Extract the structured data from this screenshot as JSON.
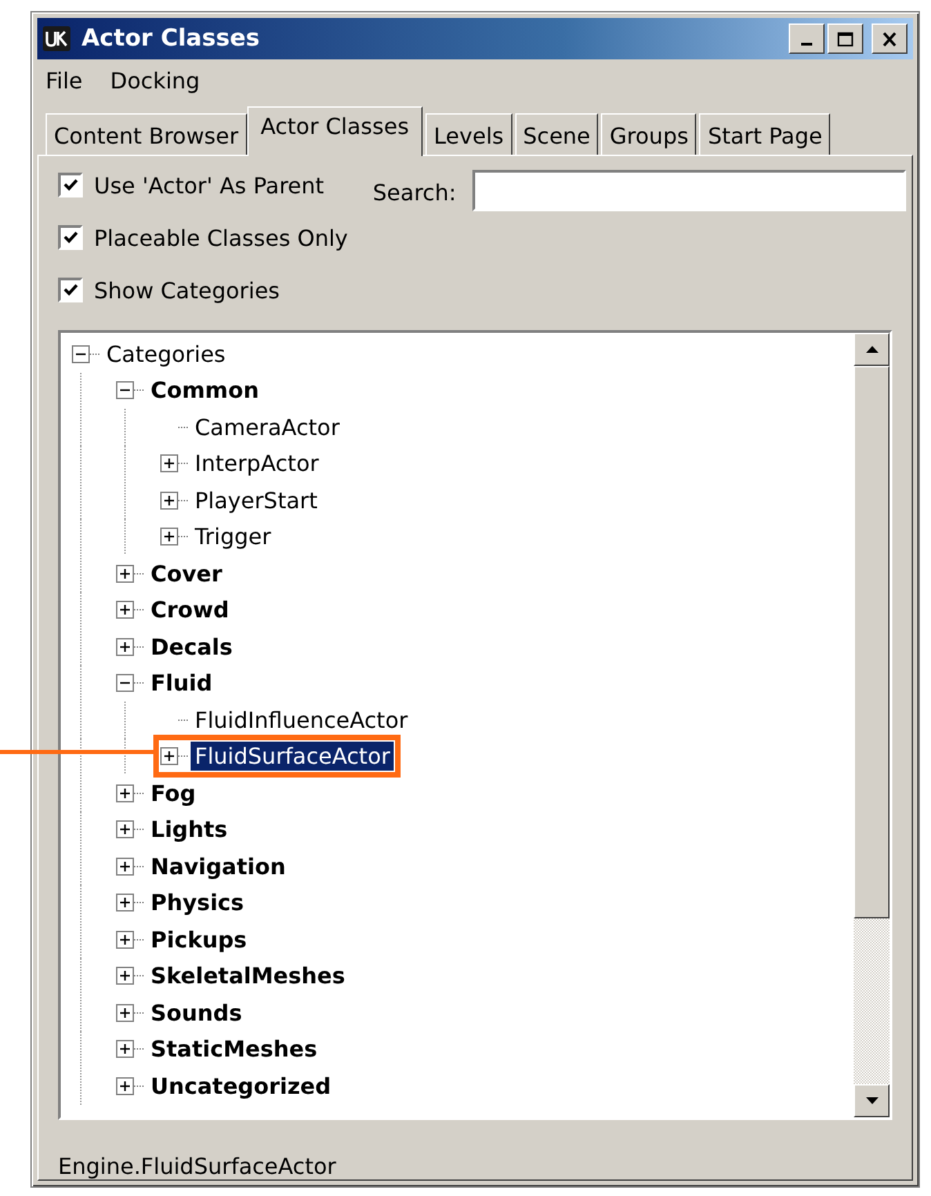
{
  "window": {
    "title": "Actor Classes"
  },
  "menu": [
    "File",
    "Docking"
  ],
  "tabs": [
    {
      "label": "Content Browser",
      "selected": false
    },
    {
      "label": "Actor Classes",
      "selected": true
    },
    {
      "label": "Levels",
      "selected": false
    },
    {
      "label": "Scene",
      "selected": false
    },
    {
      "label": "Groups",
      "selected": false
    },
    {
      "label": "Start Page",
      "selected": false
    }
  ],
  "options": [
    {
      "label": "Use 'Actor' As Parent",
      "checked": true
    },
    {
      "label": "Placeable Classes Only",
      "checked": true
    },
    {
      "label": "Show Categories",
      "checked": true
    }
  ],
  "search": {
    "label": "Search:"
  },
  "tree": {
    "root": {
      "label": "Categories",
      "expanded": true,
      "selected": false,
      "children": [
        {
          "label": "Common",
          "expanded": true,
          "selected": false,
          "children": [
            {
              "label": "CameraActor",
              "selected": false
            },
            {
              "label": "InterpActor",
              "expanded": false,
              "selected": false
            },
            {
              "label": "PlayerStart",
              "expanded": false,
              "selected": false
            },
            {
              "label": "Trigger",
              "expanded": false,
              "selected": false
            }
          ]
        },
        {
          "label": "Cover",
          "expanded": false,
          "selected": false
        },
        {
          "label": "Crowd",
          "expanded": false,
          "selected": false
        },
        {
          "label": "Decals",
          "expanded": false,
          "selected": false
        },
        {
          "label": "Fluid",
          "expanded": true,
          "selected": false,
          "children": [
            {
              "label": "FluidInfluenceActor",
              "selected": false
            },
            {
              "label": "FluidSurfaceActor",
              "expanded": false,
              "selected": true,
              "callout": true
            }
          ]
        },
        {
          "label": "Fog",
          "expanded": false,
          "selected": false
        },
        {
          "label": "Lights",
          "expanded": false,
          "selected": false
        },
        {
          "label": "Navigation",
          "expanded": false,
          "selected": false
        },
        {
          "label": "Physics",
          "expanded": false,
          "selected": false
        },
        {
          "label": "Pickups",
          "expanded": false,
          "selected": false
        },
        {
          "label": "SkeletalMeshes",
          "expanded": false,
          "selected": false
        },
        {
          "label": "Sounds",
          "expanded": false,
          "selected": false
        },
        {
          "label": "StaticMeshes",
          "expanded": false,
          "selected": false
        },
        {
          "label": "Uncategorized",
          "expanded": false,
          "selected": false
        }
      ]
    }
  },
  "status_bar": "Engine.FluidSurfaceActor"
}
